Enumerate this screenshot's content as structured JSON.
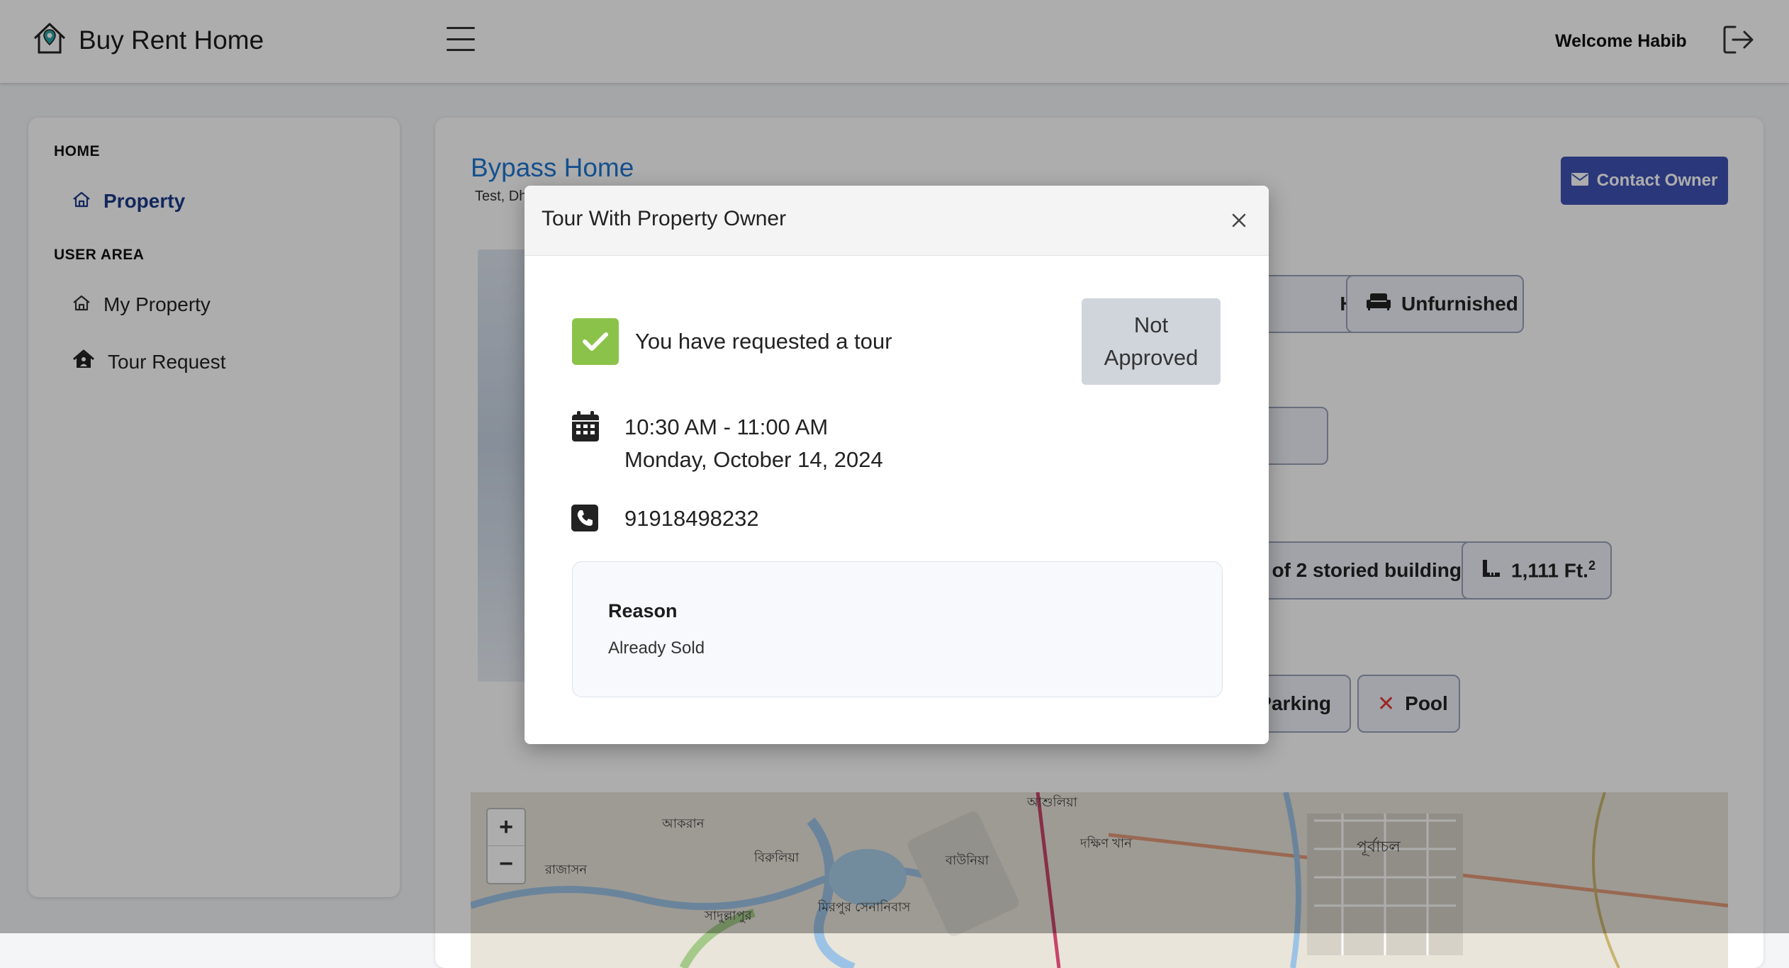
{
  "header": {
    "brand": "Buy Rent Home",
    "welcome": "Welcome Habib"
  },
  "sidebar": {
    "sections": [
      {
        "label": "HOME",
        "items": [
          {
            "label": "Property",
            "icon": "home-icon",
            "active": true
          }
        ]
      },
      {
        "label": "USER AREA",
        "items": [
          {
            "label": "My Property",
            "icon": "home-icon"
          },
          {
            "label": "Tour Request",
            "icon": "home-person-icon"
          }
        ]
      }
    ]
  },
  "property": {
    "title": "Bypass Home",
    "subtitle": "Test, Dh",
    "contact_label": "Contact Owner",
    "chips": {
      "type": "House",
      "furnishing": "Unfurnished",
      "building": "of 2 storied building",
      "area": "1,111 Ft.",
      "area_sup": "2",
      "parking": "Parking",
      "pool": "Pool"
    }
  },
  "map": {
    "zoom_in": "+",
    "zoom_out": "−",
    "labels": [
      "আকরান",
      "রাজাসন",
      "বিরুলিয়া",
      "বাউনিয়া",
      "দক্ষিণ খান",
      "পূর্বাচল",
      "সাদুল্লাপুর",
      "মিরপুর সেনানিবাস",
      "আশুলিয়া"
    ]
  },
  "modal": {
    "title": "Tour With Property Owner",
    "request_text": "You have requested a tour",
    "status_line1": "Not",
    "status_line2": "Approved",
    "time": "10:30 AM - 11:00 AM",
    "date": "Monday, October 14, 2024",
    "phone": "91918498232",
    "reason_label": "Reason",
    "reason_text": "Already Sold"
  },
  "colors": {
    "accent": "#3f51b5",
    "title_blue": "#1f76d2",
    "success": "#8bc34a",
    "pool_x": "#e53935"
  }
}
